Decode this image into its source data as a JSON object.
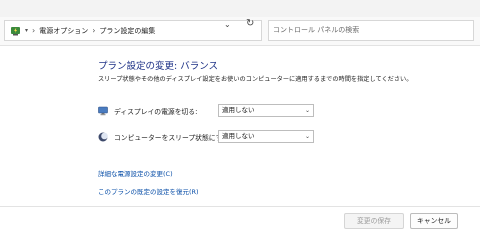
{
  "address_bar": {
    "breadcrumbs": [
      "電源オプション",
      "プラン設定の編集"
    ],
    "search_placeholder": "コントロール パネルの検索"
  },
  "main": {
    "title": "プラン設定の変更: バランス",
    "description": "スリープ状態やその他のディスプレイ設定をお使いのコンピューターに適用するまでの時間を指定してください。",
    "settings": [
      {
        "label": "ディスプレイの電源を切る:",
        "value": "適用しない",
        "icon": "monitor-icon"
      },
      {
        "label": "コンピューターをスリープ状態にする:",
        "value": "適用しない",
        "icon": "moon-icon"
      }
    ],
    "links": [
      "詳細な電源設定の変更(C)",
      "このプランの既定の設定を復元(R)"
    ]
  },
  "footer": {
    "save_label": "変更の保存",
    "cancel_label": "キャンセル"
  },
  "colors": {
    "title": "#1e3287",
    "link": "#0a4fa8"
  }
}
